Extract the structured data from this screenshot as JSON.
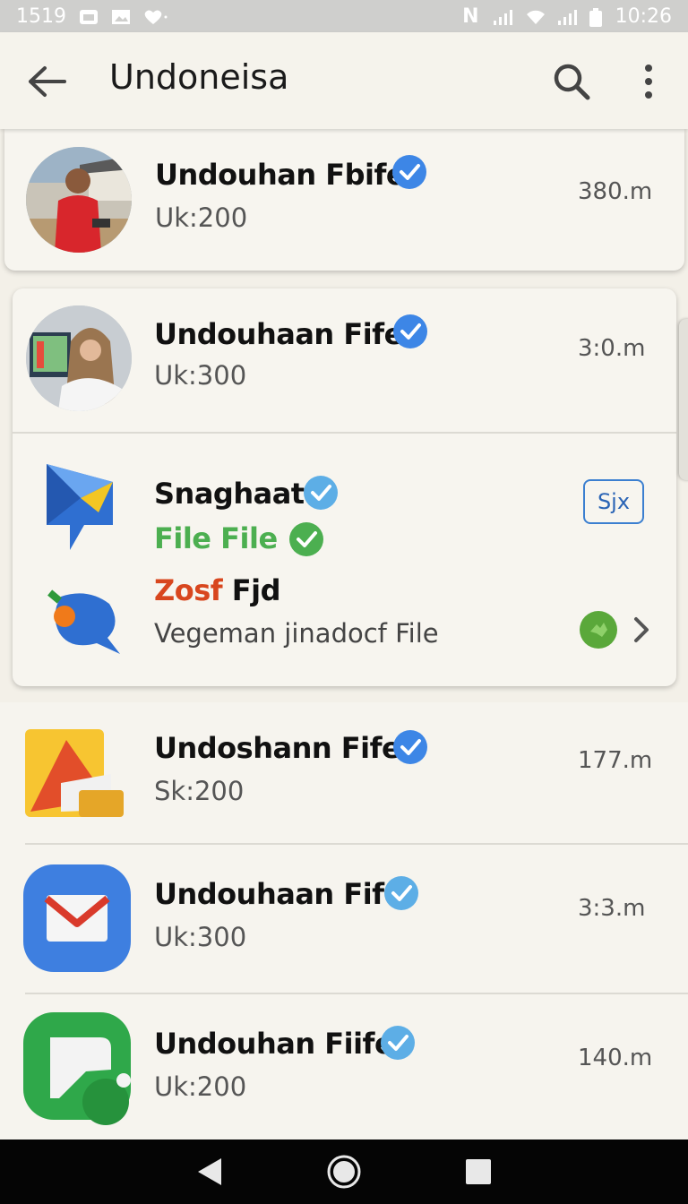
{
  "status_bar": {
    "time_left": "1519",
    "time_right": "10:26",
    "right_label": "N"
  },
  "app_bar": {
    "title": "Undoneisa"
  },
  "items": [
    {
      "name": "Undouhan Fbife",
      "sub": "Uk:200",
      "size": "380.m"
    },
    {
      "name": "Undouhaan Fife",
      "sub": "Uk:300",
      "size": "3:0.m"
    },
    {
      "name": "Undoshann Fife",
      "sub": "Sk:200",
      "size": "177.m"
    },
    {
      "name": "Undouhaan Fife",
      "sub": "Uk:300",
      "size": "3:3.m"
    },
    {
      "name": "Undouhan Fiife",
      "sub": "Uk:200",
      "size": "140.m"
    }
  ],
  "expanded": {
    "title": "Snaghaat",
    "file_label": "File File",
    "zosf_part1": "Zosf",
    "zosf_part2": "Fjd",
    "description": "Vegeman jinadocf File",
    "badge": "Sjx"
  },
  "colors": {
    "verified_blue": "#3d86e6",
    "file_green": "#4caf50",
    "zosf_red": "#d8461e"
  }
}
